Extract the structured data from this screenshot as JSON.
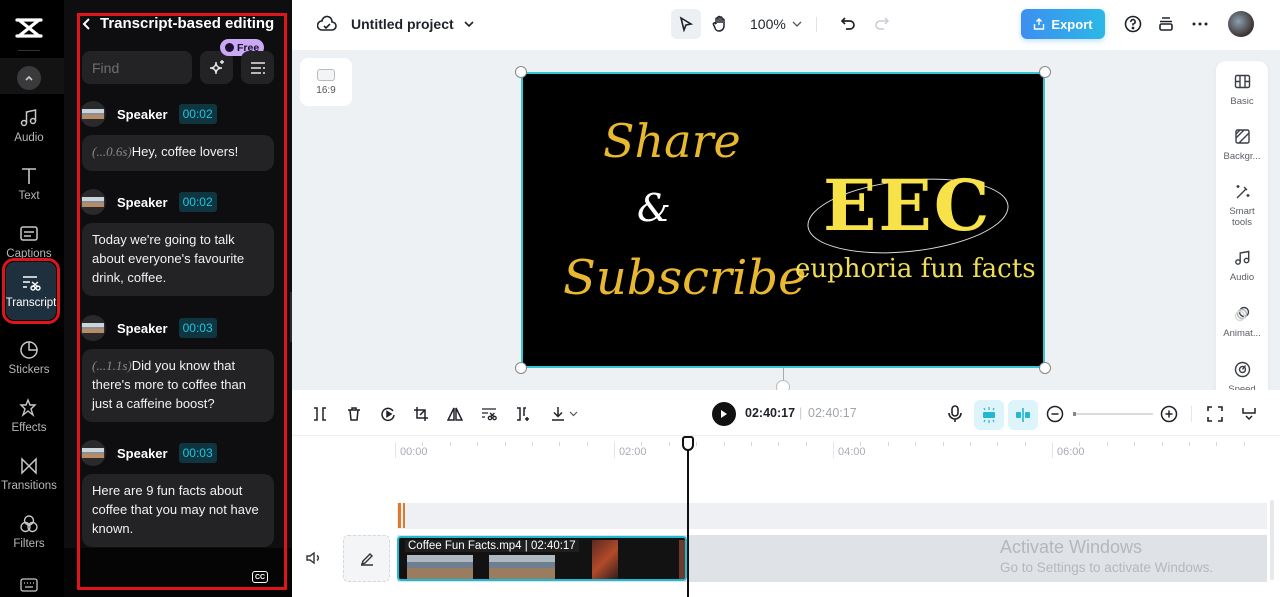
{
  "rail": {
    "items": [
      {
        "label": "Audio",
        "icon": "music-note-icon"
      },
      {
        "label": "Text",
        "icon": "text-icon"
      },
      {
        "label": "Captions",
        "icon": "captions-icon"
      },
      {
        "label": "Transcript",
        "icon": "transcript-icon",
        "active": true
      },
      {
        "label": "Stickers",
        "icon": "sticker-icon"
      },
      {
        "label": "Effects",
        "icon": "effects-icon"
      },
      {
        "label": "Transitions",
        "icon": "transitions-icon"
      },
      {
        "label": "Filters",
        "icon": "filters-icon"
      }
    ]
  },
  "transcript": {
    "title": "Transcript-based editing",
    "find_placeholder": "Find",
    "free_badge": "Free",
    "entries": [
      {
        "speaker": "Speaker",
        "time": "00:02",
        "pause": "(...0.6s)",
        "text": "Hey, coffee lovers!"
      },
      {
        "speaker": "Speaker",
        "time": "00:02",
        "pause": "",
        "text": "Today we're going to talk about everyone's favourite drink, coffee."
      },
      {
        "speaker": "Speaker",
        "time": "00:03",
        "pause": "(...1.1s)",
        "text": "Did you know that there's more to coffee than just a caffeine boost?"
      },
      {
        "speaker": "Speaker",
        "time": "00:03",
        "pause": "",
        "text": "Here are 9 fun facts about coffee that you may not have known."
      }
    ],
    "cc_label": "CC"
  },
  "topbar": {
    "project_name": "Untitled project",
    "zoom": "100%",
    "export_label": "Export"
  },
  "stage": {
    "aspect_ratio": "16:9",
    "video_text": {
      "share": "Share",
      "amp": "&",
      "subscribe": "Subscribe",
      "logo": "EEC",
      "tagline": "euphoria fun facts"
    }
  },
  "props": {
    "items": [
      {
        "label": "Basic",
        "icon": "basic-icon"
      },
      {
        "label": "Backgr...",
        "icon": "background-icon"
      },
      {
        "label": "Smart tools",
        "icon": "smart-tools-icon"
      },
      {
        "label": "Audio",
        "icon": "audio-icon"
      },
      {
        "label": "Animat...",
        "icon": "animation-icon"
      },
      {
        "label": "Speed",
        "icon": "speed-icon"
      }
    ]
  },
  "timeline": {
    "current_time": "02:40:17",
    "separator": "|",
    "total_time": "02:40:17",
    "ruler_labels": [
      "00:00",
      "02:00",
      "04:00",
      "06:00"
    ],
    "clip_label": "Coffee Fun Facts.mp4 | 02:40:17"
  },
  "watermark": {
    "line1": "Activate Windows",
    "line2": "Go to Settings to activate Windows."
  },
  "colors": {
    "accent": "#1fb9d1",
    "highlight_frame": "#e0151b",
    "export_gradient_start": "#3d8ff0",
    "export_gradient_end": "#2bb8e6",
    "audio_marker": "#e07a2a"
  }
}
